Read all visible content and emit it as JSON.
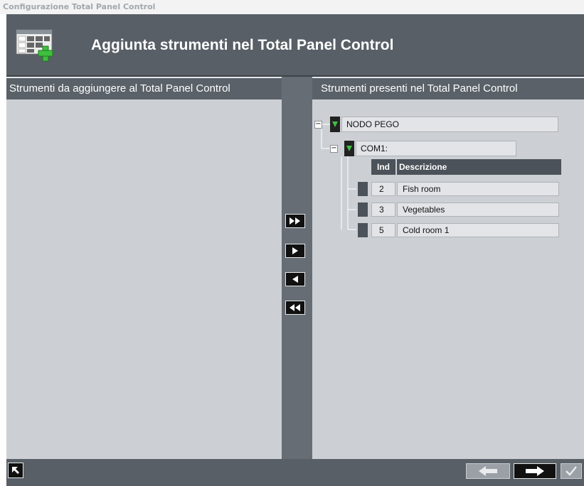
{
  "window": {
    "title": "Configurazione Total Panel Control"
  },
  "header": {
    "title": "Aggiunta strumenti nel Total Panel Control",
    "icon": "panel-add-icon"
  },
  "left_panel": {
    "title": "Strumenti da aggiungere al Total Panel Control"
  },
  "right_panel": {
    "title": "Strumenti presenti nel Total Panel Control"
  },
  "transfer_buttons": [
    {
      "icon": "add-all-icon"
    },
    {
      "icon": "add-selected-icon"
    },
    {
      "icon": "remove-selected-icon"
    },
    {
      "icon": "remove-all-icon"
    }
  ],
  "tree": {
    "root": {
      "label": "NODO PEGO",
      "expander": "−"
    },
    "port": {
      "label": "COM1:",
      "expander": "−"
    },
    "columns": {
      "ind": "Ind",
      "descrizione": "Descrizione"
    },
    "rows": [
      {
        "ind": "2",
        "descrizione": "Fish room"
      },
      {
        "ind": "3",
        "descrizione": "Vegetables"
      },
      {
        "ind": "5",
        "descrizione": "Cold room 1"
      }
    ]
  },
  "footer": {
    "back_icon": "back-icon",
    "prev_icon": "arrow-left-icon",
    "next_icon": "arrow-right-icon",
    "confirm_icon": "checkmark-icon"
  },
  "colors": {
    "panel_bg": "#ccd0d5",
    "frame_bg": "#585f66",
    "accent_green": "#3fbf3f"
  }
}
